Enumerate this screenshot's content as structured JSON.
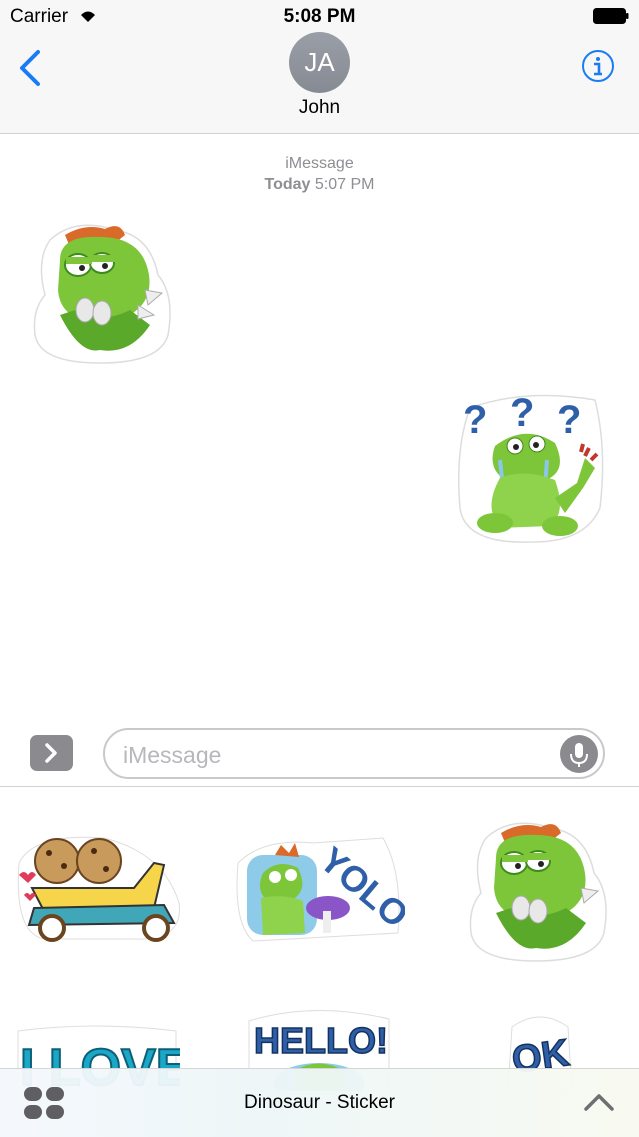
{
  "status_bar": {
    "carrier": "Carrier",
    "time": "5:08 PM"
  },
  "nav": {
    "avatar_initials": "JA",
    "contact_name": "John"
  },
  "thread": {
    "service": "iMessage",
    "day": "Today",
    "time": "5:07 PM"
  },
  "messages": [
    {
      "sticker": "thinking-dinosaur-sticker",
      "side": "left"
    },
    {
      "sticker": "confused-dinosaur-sticker",
      "side": "right"
    }
  ],
  "composer": {
    "placeholder": "iMessage"
  },
  "drawer": {
    "title": "Dinosaur - Sticker",
    "stickers": [
      "cookies-on-scooter-sticker",
      "yolo-dinosaur-sticker",
      "thinking-dinosaur-sticker",
      "i-love-sticker",
      "hello-dinosaur-sticker",
      "ok-sticker"
    ],
    "sticker_text": {
      "yolo": "YOLO",
      "i_love": "I LOVE",
      "hello": "HELLO!",
      "ok": "OK"
    }
  },
  "colors": {
    "accent": "#1a7cf5",
    "dino_green": "#7dc63a",
    "dino_dark": "#3f8a1e",
    "gray_button": "#8a8a8f"
  }
}
